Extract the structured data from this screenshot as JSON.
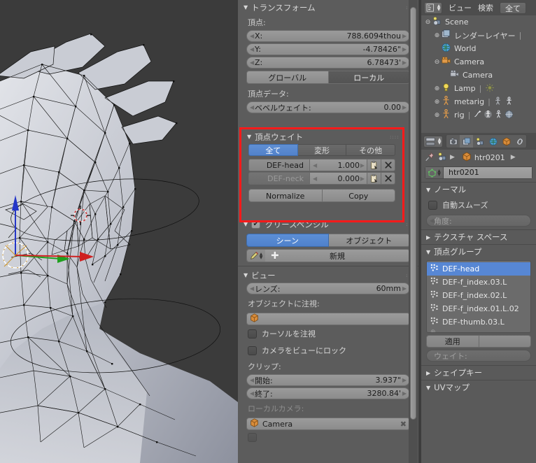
{
  "viewport": {
    "name": "3d-viewport",
    "background": "#3b3b3b",
    "mesh_fill": "#b9bcc6",
    "wire_color": "#101010",
    "gizmo": {
      "x_color": "#e02020",
      "y_color": "#20c020",
      "z_color": "#2020e0"
    },
    "cursor_color": "#d23a3a"
  },
  "npanel": {
    "transform": {
      "title": "トランスフォーム",
      "vertex_label": "頂点:",
      "fields": [
        {
          "label": "X:",
          "value": "788.6094thou"
        },
        {
          "label": "Y:",
          "value": "-4.78426\""
        },
        {
          "label": "Z:",
          "value": "6.78473'"
        }
      ],
      "space_global": "グローバル",
      "space_local": "ローカル",
      "vertex_data_label": "頂点データ:",
      "bevel_weight_label": "ベベルウェイト:",
      "bevel_weight_value": "0.00"
    },
    "vertex_weights": {
      "title": "頂点ウェイト",
      "highlight_color": "#ff1a1a",
      "tabs": [
        {
          "label": "全て",
          "active": true
        },
        {
          "label": "変形",
          "active": false
        },
        {
          "label": "その他",
          "active": false
        }
      ],
      "rows": [
        {
          "name": "DEF-head",
          "value": "1.000",
          "dim": false
        },
        {
          "name": "DEF-neck",
          "value": "0.000",
          "dim": true
        }
      ],
      "normalize_label": "Normalize",
      "copy_label": "Copy",
      "copy_icon": "clipboard-icon",
      "delete_icon": "x-icon"
    },
    "grease_pencil": {
      "title": "グリースペンシル",
      "checked": true,
      "scene_label": "シーン",
      "object_label": "オブジェクト",
      "pencil_icon": "pencil-icon",
      "plus_icon": "plus-icon",
      "new_label": "新規"
    },
    "view": {
      "title": "ビュー",
      "lens_label": "レンズ:",
      "lens_value": "60mm",
      "lock_object_label": "オブジェクトに注視:",
      "lock_object_value": "",
      "lock_object_icon": "object-cube-icon",
      "lock_cursor_label": "カーソルを注視",
      "lock_camera_label": "カメラをビューにロック",
      "clip_label": "クリップ:",
      "clip_start_label": "開始:",
      "clip_start_value": "3.937\"",
      "clip_end_label": "終了:",
      "clip_end_value": "3280.84'",
      "local_camera_label": "ローカルカメラ:",
      "local_camera_value": "Camera",
      "local_camera_icon": "object-cube-icon"
    }
  },
  "outliner": {
    "display_mode_icon": "outliner-mode-icon",
    "menu_view": "ビュー",
    "menu_search": "検索",
    "filter_all": "全て",
    "rows": [
      {
        "label": "Scene",
        "icon": "scene-icon",
        "indent": 0,
        "expander": "minus",
        "extra": []
      },
      {
        "label": "レンダーレイヤー",
        "icon": "render-layers-icon",
        "indent": 1,
        "expander": "plus",
        "extra": [
          "divider"
        ]
      },
      {
        "label": "World",
        "icon": "world-icon",
        "indent": 1,
        "expander": "none",
        "extra": []
      },
      {
        "label": "Camera",
        "icon": "camera-object-icon",
        "indent": 1,
        "expander": "minus",
        "extra": []
      },
      {
        "label": "Camera",
        "icon": "camera-data-icon",
        "indent": 2,
        "expander": "none",
        "extra": []
      },
      {
        "label": "Lamp",
        "icon": "lamp-icon",
        "indent": 1,
        "expander": "plus",
        "extra": [
          "divider",
          "lamp-data-icon"
        ]
      },
      {
        "label": "metarig",
        "icon": "armature-icon",
        "indent": 1,
        "expander": "plus",
        "extra": [
          "divider",
          "pose-icon",
          "armature-data-icon"
        ]
      },
      {
        "label": "rig",
        "icon": "armature-icon",
        "indent": 1,
        "expander": "plus",
        "extra": [
          "divider",
          "animation-icon",
          "pose-icon",
          "armature-data-icon",
          "mesh-icon"
        ]
      }
    ]
  },
  "properties": {
    "tabs": [
      {
        "icon": "render-icon",
        "active": false
      },
      {
        "icon": "render-layers-icon",
        "active": true
      },
      {
        "icon": "scene-icon",
        "active": false
      },
      {
        "icon": "world-icon",
        "active": false
      },
      {
        "icon": "object-icon",
        "active": false
      },
      {
        "icon": "constraints-icon",
        "active": false
      }
    ],
    "pin_icon": "pin-icon",
    "breadcrumb_scene_icon": "scene-icon",
    "breadcrumb_object_icon": "object-cube-icon",
    "breadcrumb_object": "htr0201",
    "datablock_icon": "mesh-data-icon",
    "datablock_name": "htr0201",
    "sections": {
      "normals": {
        "title": "ノーマル",
        "auto_smooth_label": "自動スムーズ",
        "auto_smooth_checked": false,
        "angle_label": "角度:"
      },
      "texture_space": {
        "title": "テクスチャ スペース",
        "expanded": false
      },
      "vertex_groups": {
        "title": "頂点グループ",
        "expanded": true,
        "items": [
          {
            "label": "DEF-head",
            "selected": true
          },
          {
            "label": "DEF-f_index.03.L",
            "selected": false
          },
          {
            "label": "DEF-f_index.02.L",
            "selected": false
          },
          {
            "label": "DEF-f_index.01.L.02",
            "selected": false
          },
          {
            "label": "DEF-thumb.03.L",
            "selected": false
          }
        ],
        "apply_label": "適用",
        "weight_label": "ウェイト:"
      },
      "shape_keys": {
        "title": "シェイプキー",
        "expanded": false
      },
      "uv_maps": {
        "title": "UVマップ",
        "expanded": true
      }
    }
  }
}
